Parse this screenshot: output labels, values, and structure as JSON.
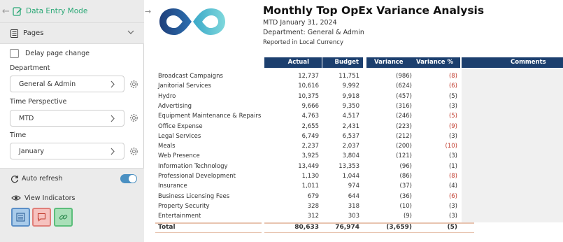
{
  "sidebar": {
    "mode_label": "Data Entry Mode",
    "pages_label": "Pages",
    "delay_label": "Delay page change",
    "department": {
      "label": "Department",
      "value": "General & Admin"
    },
    "time_perspective": {
      "label": "Time Perspective",
      "value": "MTD"
    },
    "time": {
      "label": "Time",
      "value": "January"
    },
    "auto_refresh_label": "Auto refresh",
    "auto_refresh_on": true,
    "view_indicators_label": "View Indicators"
  },
  "report": {
    "title": "Monthly Top OpEx Variance Analysis",
    "date": "MTD January 31, 2024",
    "department": "Department: General & Admin",
    "currency_note": "Reported in Local Currency",
    "headers": {
      "actual": "Actual",
      "budget": "Budget",
      "variance": "Variance",
      "variance_pct": "Variance %",
      "comments": "Comments"
    },
    "rows": [
      {
        "name": "Broadcast Campaigns",
        "actual": "12,737",
        "budget": "11,751",
        "variance": "(986)",
        "pct": "(8)",
        "pct_red": true
      },
      {
        "name": "Janitorial Services",
        "actual": "10,616",
        "budget": "9,992",
        "variance": "(624)",
        "pct": "(6)",
        "pct_red": true
      },
      {
        "name": "Hydro",
        "actual": "10,375",
        "budget": "9,918",
        "variance": "(457)",
        "pct": "(5)",
        "pct_red": false
      },
      {
        "name": "Advertising",
        "actual": "9,666",
        "budget": "9,350",
        "variance": "(316)",
        "pct": "(3)",
        "pct_red": false
      },
      {
        "name": "Equipment Maintenance & Repairs",
        "actual": "4,763",
        "budget": "4,517",
        "variance": "(246)",
        "pct": "(5)",
        "pct_red": true
      },
      {
        "name": "Office Expense",
        "actual": "2,655",
        "budget": "2,431",
        "variance": "(223)",
        "pct": "(9)",
        "pct_red": true
      },
      {
        "name": "Legal Services",
        "actual": "6,749",
        "budget": "6,537",
        "variance": "(212)",
        "pct": "(3)",
        "pct_red": false
      },
      {
        "name": "Meals",
        "actual": "2,237",
        "budget": "2,037",
        "variance": "(200)",
        "pct": "(10)",
        "pct_red": true
      },
      {
        "name": "Web Presence",
        "actual": "3,925",
        "budget": "3,804",
        "variance": "(121)",
        "pct": "(3)",
        "pct_red": false
      },
      {
        "name": "Information Technology",
        "actual": "13,449",
        "budget": "13,353",
        "variance": "(96)",
        "pct": "(1)",
        "pct_red": false
      },
      {
        "name": "Professional Development",
        "actual": "1,130",
        "budget": "1,044",
        "variance": "(86)",
        "pct": "(8)",
        "pct_red": true
      },
      {
        "name": "Insurance",
        "actual": "1,011",
        "budget": "974",
        "variance": "(37)",
        "pct": "(4)",
        "pct_red": false
      },
      {
        "name": "Business Licensing Fees",
        "actual": "679",
        "budget": "644",
        "variance": "(36)",
        "pct": "(6)",
        "pct_red": true
      },
      {
        "name": "Property Security",
        "actual": "328",
        "budget": "318",
        "variance": "(10)",
        "pct": "(3)",
        "pct_red": false
      },
      {
        "name": "Entertainment",
        "actual": "312",
        "budget": "303",
        "variance": "(9)",
        "pct": "(3)",
        "pct_red": false
      }
    ],
    "total": {
      "name": "Total",
      "actual": "80,633",
      "budget": "76,974",
      "variance": "(3,659)",
      "pct": "(5)"
    }
  },
  "colors": {
    "header_bg": "#1c3f6e",
    "accent_green": "#2aa876",
    "negative_red": "#c0392b"
  }
}
